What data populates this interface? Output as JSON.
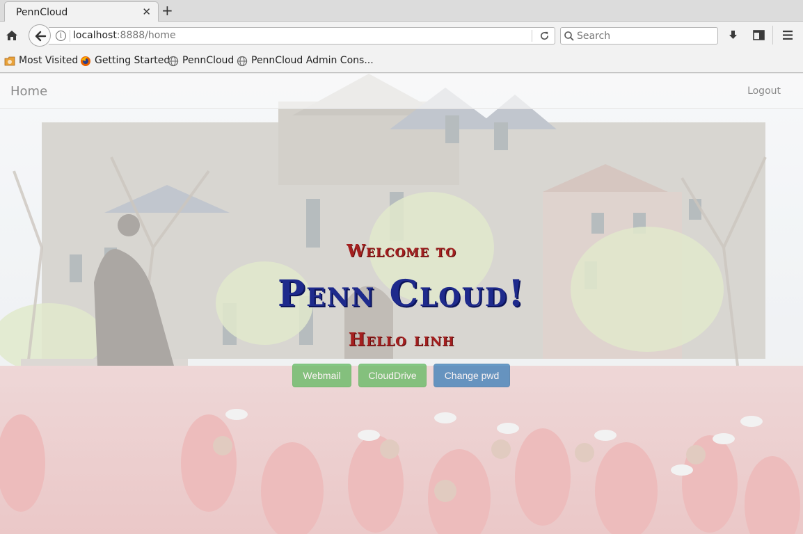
{
  "browser": {
    "tab_title": "PennCloud",
    "tab_close": "✕",
    "new_tab": "+",
    "url_host": "localhost",
    "url_rest": ":8888/home",
    "search_placeholder": "Search",
    "bookmarks": [
      "Most Visited",
      "Getting Started",
      "PennCloud",
      "PennCloud Admin Cons..."
    ]
  },
  "page": {
    "nav": {
      "brand": "Home",
      "logout": "Logout"
    },
    "heading": {
      "welcome": "Welcome to",
      "title": "Penn Cloud!",
      "greeting": "Hello linh"
    },
    "buttons": {
      "webmail": "Webmail",
      "clouddrive": "CloudDrive",
      "change_pwd": "Change pwd"
    }
  },
  "colors": {
    "heading_red": "#a51f1f",
    "title_blue": "#1e2a8c",
    "btn_green": "#5cb85c",
    "btn_blue": "#337ab7"
  }
}
